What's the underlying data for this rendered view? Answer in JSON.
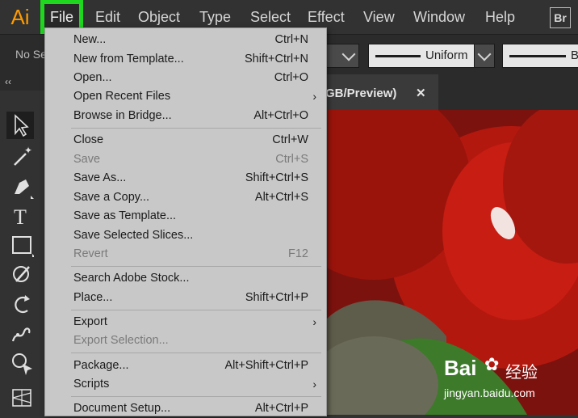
{
  "app": {
    "logo": "Ai",
    "bridge_logo": "Br"
  },
  "menubar": {
    "items": [
      {
        "label": "File"
      },
      {
        "label": "Edit"
      },
      {
        "label": "Object"
      },
      {
        "label": "Type"
      },
      {
        "label": "Select"
      },
      {
        "label": "Effect"
      },
      {
        "label": "View"
      },
      {
        "label": "Window"
      },
      {
        "label": "Help"
      }
    ]
  },
  "controlbar": {
    "selection_text": "No Se",
    "stroke_profile": "Uniform",
    "brush_partial": "B"
  },
  "tools_panel": {
    "collapse_label": "‹‹"
  },
  "document_tab": {
    "title": "GB/Preview)",
    "close_label": "✕"
  },
  "file_menu": {
    "items": [
      {
        "label": "New...",
        "shortcut": "Ctrl+N",
        "enabled": true
      },
      {
        "label": "New from Template...",
        "shortcut": "Shift+Ctrl+N",
        "enabled": true
      },
      {
        "label": "Open...",
        "shortcut": "Ctrl+O",
        "enabled": true
      },
      {
        "label": "Open Recent Files",
        "shortcut": "",
        "enabled": true,
        "submenu": true
      },
      {
        "label": "Browse in Bridge...",
        "shortcut": "Alt+Ctrl+O",
        "enabled": true
      },
      {
        "label": "Close",
        "shortcut": "Ctrl+W",
        "enabled": true
      },
      {
        "label": "Save",
        "shortcut": "Ctrl+S",
        "enabled": false
      },
      {
        "label": "Save As...",
        "shortcut": "Shift+Ctrl+S",
        "enabled": true
      },
      {
        "label": "Save a Copy...",
        "shortcut": "Alt+Ctrl+S",
        "enabled": true
      },
      {
        "label": "Save as Template...",
        "shortcut": "",
        "enabled": true
      },
      {
        "label": "Save Selected Slices...",
        "shortcut": "",
        "enabled": true
      },
      {
        "label": "Revert",
        "shortcut": "F12",
        "enabled": false
      },
      {
        "label": "Search Adobe Stock...",
        "shortcut": "",
        "enabled": true
      },
      {
        "label": "Place...",
        "shortcut": "Shift+Ctrl+P",
        "enabled": true
      },
      {
        "label": "Export",
        "shortcut": "",
        "enabled": true,
        "submenu": true
      },
      {
        "label": "Export Selection...",
        "shortcut": "",
        "enabled": false
      },
      {
        "label": "Package...",
        "shortcut": "Alt+Shift+Ctrl+P",
        "enabled": true
      },
      {
        "label": "Scripts",
        "shortcut": "",
        "enabled": true,
        "submenu": true
      },
      {
        "label": "Document Setup...",
        "shortcut": "Alt+Ctrl+P",
        "enabled": true
      }
    ]
  },
  "watermark": {
    "brand": "Bai",
    "brand_cn": "经验",
    "url": "jingyan.baidu.com"
  },
  "colors": {
    "highlight": "#1fd71f",
    "ai_orange": "#FF9A00",
    "menu_bg": "#c8c8c8"
  }
}
